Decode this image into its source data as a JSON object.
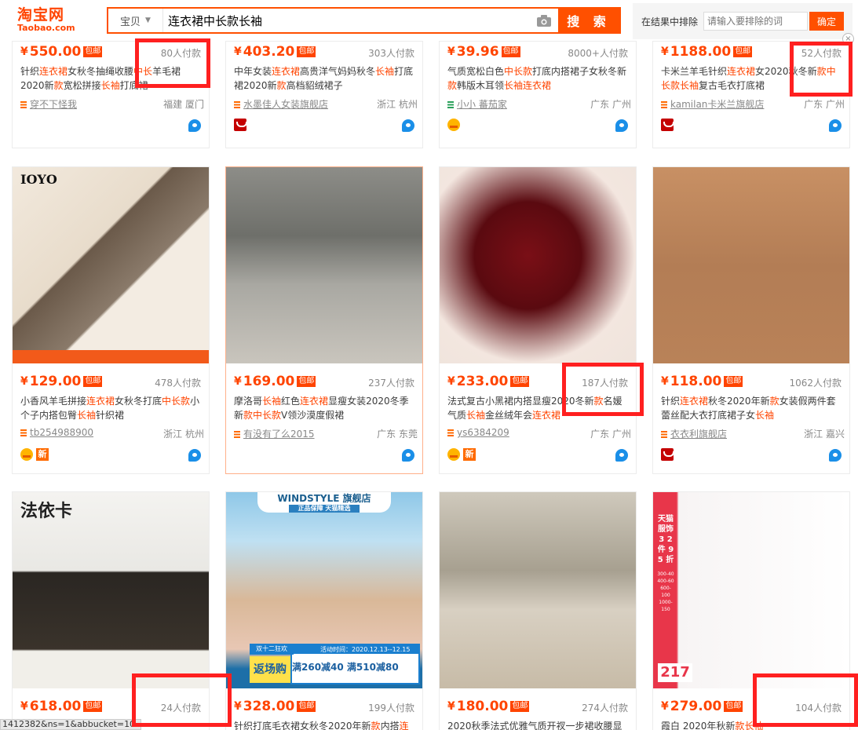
{
  "header": {
    "logo_cn": "淘宝网",
    "logo_en": "Taobao.com",
    "scope": "宝贝",
    "search_value": "连衣裙中长款长袖",
    "search_button": "搜 索",
    "exclude_label": "在结果中排除",
    "exclude_placeholder": "请输入要排除的词",
    "exclude_button": "确定"
  },
  "currency": "¥",
  "free_ship": "包邮",
  "products": [
    {
      "price": "550.00",
      "sales": "80人付款",
      "title": [
        "针织",
        [
          "连衣裙"
        ],
        "女秋冬抽绳收腰",
        [
          "中长"
        ],
        "羊毛裙2020新",
        [
          "款"
        ],
        "宽松拼接",
        [
          "长袖"
        ],
        "打底裙"
      ],
      "shop": "穿不下怪我",
      "location": "福建 厦门",
      "badges": []
    },
    {
      "price": "403.20",
      "sales": "303人付款",
      "title": [
        "中年女装",
        [
          "连衣裙"
        ],
        "高贵洋气妈妈秋冬",
        [
          "长袖"
        ],
        "打底裙2020新",
        [
          "款"
        ],
        "高档貂绒裙子"
      ],
      "shop": "水墨佳人女装旗舰店",
      "location": "浙江 杭州",
      "badges": [
        "tmall"
      ]
    },
    {
      "price": "39.96",
      "sales": "8000+人付款",
      "title": [
        "气质宽松白色",
        [
          "中长款"
        ],
        "打底内搭裙子女秋冬新",
        [
          "款"
        ],
        "韩版木耳领",
        [
          "长袖连衣裙"
        ]
      ],
      "shop": "小小 蕃茄家",
      "shop_green": true,
      "location": "广东 广州",
      "badges": [
        "gold"
      ]
    },
    {
      "price": "1188.00",
      "sales": "52人付款",
      "title": [
        "卡米兰羊毛针织",
        [
          "连衣裙"
        ],
        "女2020秋冬新",
        [
          "款中长款长袖"
        ],
        "复古毛衣打底裙"
      ],
      "shop": "kamilan卡米兰旗舰店",
      "location": "广东 广州",
      "badges": [
        "tmall"
      ]
    },
    {
      "price": "129.00",
      "sales": "478人付款",
      "title": [
        "小香风羊毛拼接",
        [
          "连衣裙"
        ],
        "女秋冬打底",
        [
          "中长款"
        ],
        "小个子内搭包臀",
        [
          "长袖"
        ],
        "针织裙"
      ],
      "shop": "tb254988900",
      "location": "浙江 杭州",
      "badges": [
        "gold",
        "new"
      ],
      "watermark": "IOYO"
    },
    {
      "price": "169.00",
      "sales": "237人付款",
      "title": [
        "摩洛哥",
        [
          "长袖"
        ],
        "红色",
        [
          "连衣裙"
        ],
        "显瘦女装2020冬季新",
        [
          "款中长款"
        ],
        "V领沙漠度假裙"
      ],
      "shop": "有没有了么2015",
      "location": "广东 东莞",
      "badges": []
    },
    {
      "price": "233.00",
      "sales": "187人付款",
      "title": [
        "法式复古小黑裙内搭显瘦2020冬新",
        [
          "款"
        ],
        "名媛气质",
        [
          "长袖"
        ],
        "金丝绒年会",
        [
          "连衣裙"
        ]
      ],
      "shop": "ys6384209",
      "location": "广东 广州",
      "badges": [
        "gold",
        "new"
      ]
    },
    {
      "price": "118.00",
      "sales": "1062人付款",
      "title": [
        "针织",
        [
          "连衣裙"
        ],
        "秋冬2020年新",
        [
          "款"
        ],
        "女装假两件套蕾丝配大衣打底裙子女",
        [
          "长袖"
        ]
      ],
      "shop": "衣衣利旗舰店",
      "location": "浙江 嘉兴",
      "badges": [
        "tmall"
      ]
    },
    {
      "price": "618.00",
      "sales": "24人付款",
      "title": [],
      "watermark": "法依卡"
    },
    {
      "price": "328.00",
      "sales": "199人付款",
      "title": [
        "针织打底毛衣裙女秋冬2020年新",
        [
          "款"
        ],
        "内搭",
        [
          "连"
        ]
      ],
      "banner_top": "WINDSTYLE 旗舰店",
      "banner_sub": "正品保障 天猫精选",
      "promo_line1": "双十二狂欢",
      "promo_line2": "活动时间：2020.12.13--12.15",
      "promo_main": "返场购",
      "promo_deal": "满260减40 满510减80"
    },
    {
      "price": "180.00",
      "sales": "274人付款",
      "title": [
        "2020秋季法式优雅气质开衩一步裙收腰显"
      ]
    },
    {
      "price": "279.00",
      "sales": "104人付款",
      "title": [
        "霞白 2020年秋新",
        [
          "款长袖"
        ]
      ],
      "side_text": "天猫服饰 3 2 件 9 5 折",
      "side_prices": "300-40 400-60 600-100 1000-150",
      "side_sale": "217"
    }
  ],
  "statusbar": "1412382&ns=1&abbucket=10"
}
